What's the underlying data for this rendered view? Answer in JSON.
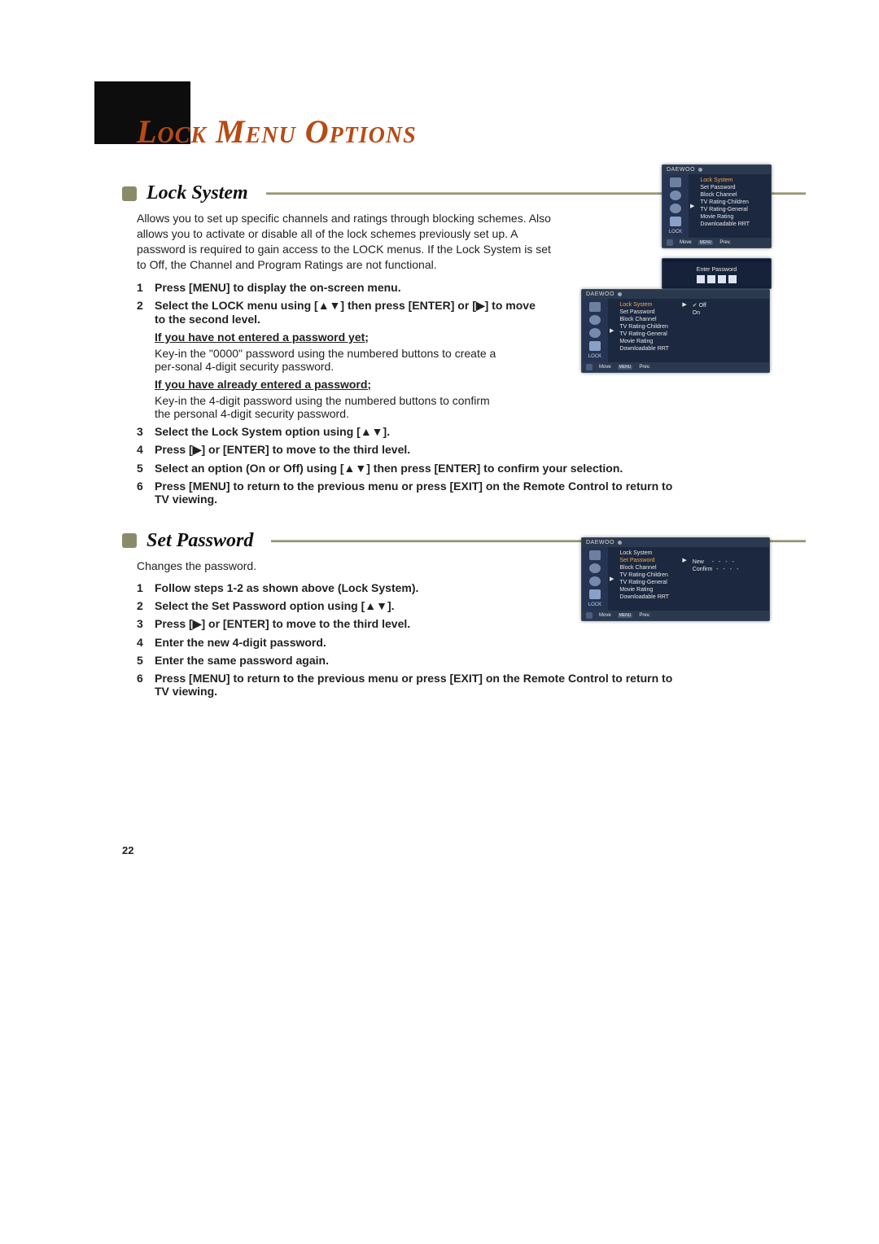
{
  "page_number": "22",
  "page_title": "Lock Menu Options",
  "sections": {
    "lock_system": {
      "heading": "Lock System",
      "intro": "Allows you to set up specific channels and ratings through blocking schemes. Also allows you to activate or disable all of the lock schemes previously set up. A password is required to gain access to the LOCK menus. If the Lock System is set to Off, the Channel and Program Ratings are not functional.",
      "steps": {
        "s1": "Press [MENU] to display the on-screen menu.",
        "s2": "Select the LOCK menu using [▲▼] then press [ENTER] or [▶] to move to the second level.",
        "s2a_head": "If you have not entered a password yet;",
        "s2a_body": "Key-in the \"0000\" password using the numbered buttons to create a per-sonal 4-digit security password.",
        "s2b_head": "If you have already entered a password;",
        "s2b_body": "Key-in the 4-digit password using the numbered buttons to confirm the personal 4-digit security password.",
        "s3": "Select the Lock System option using [▲▼].",
        "s4": "Press [▶] or [ENTER] to move to the third level.",
        "s5": "Select an option (On or Off) using [▲▼] then press [ENTER] to confirm your selection.",
        "s6": "Press [MENU] to return to the previous menu or press [EXIT] on the Remote Control to return to TV viewing."
      }
    },
    "set_password": {
      "heading": "Set Password",
      "intro": "Changes the password.",
      "steps": {
        "s1": "Follow steps 1-2 as shown above (Lock System).",
        "s2": "Select the Set Password option using [▲▼].",
        "s3": "Press [▶] or [ENTER] to move to the third level.",
        "s4": "Enter the new 4-digit password.",
        "s5": "Enter the same password again.",
        "s6": "Press [MENU] to return to the previous menu or press [EXIT] on the Remote Control to return to TV viewing."
      }
    }
  },
  "osd": {
    "brand": "DAEWOO",
    "menu_label": "LOCK",
    "move": "Move",
    "prev": "Prev.",
    "enter_password": "Enter Password",
    "items": {
      "lock_system": "Lock System",
      "set_password": "Set Password",
      "block_channel": "Block Channel",
      "tv_rating_children": "TV Rating-Children",
      "tv_rating_general": "TV Rating-General",
      "movie_rating": "Movie Rating",
      "downloadable_rrt": "Downloadable RRT"
    },
    "vals": {
      "off": "Off",
      "on": "On",
      "new": "New",
      "confirm": "Confirm"
    }
  }
}
